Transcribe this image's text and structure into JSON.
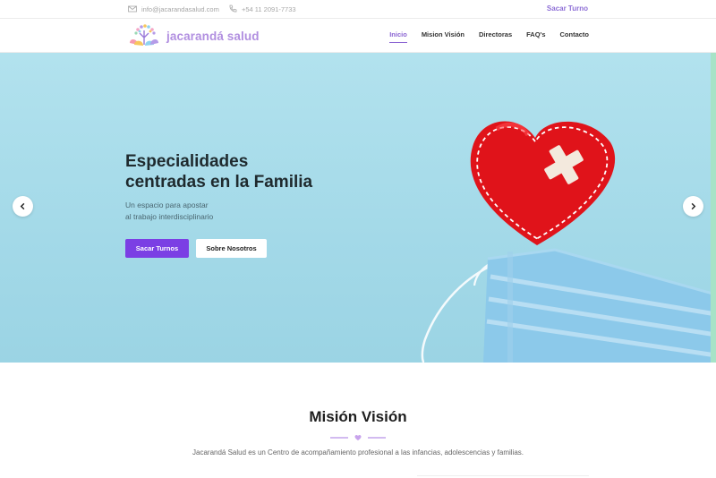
{
  "topbar": {
    "email": "info@jacarandasalud.com",
    "phone": "+54 11 2091-7733",
    "cta_link": "Sacar Turno",
    "email_icon": "mail-icon",
    "phone_icon": "phone-icon"
  },
  "navbar": {
    "brand": "jacarandá salud",
    "items": [
      {
        "label": "Inicio",
        "active": true
      },
      {
        "label": "Mision Visión"
      },
      {
        "label": "Directoras"
      },
      {
        "label": "FAQ's"
      },
      {
        "label": "Contacto"
      }
    ]
  },
  "hero": {
    "title_line1": "Especialidades",
    "title_line2": "centradas en la Familia",
    "subtitle_line1": "Un espacio para apostar",
    "subtitle_line2": "al trabajo interdisciplinario",
    "primary_button": "Sacar Turnos",
    "secondary_button": "Sobre Nosotros",
    "prev_icon": "chevron-left-icon",
    "next_icon": "chevron-right-icon"
  },
  "mision": {
    "title": "Misión Visión",
    "text": "Jacarandá Salud es un Centro de acompañamiento profesional a las infancias, adolescencias y familias.",
    "divider_icon": "heart-icon"
  },
  "colors": {
    "brand_purple": "#7b3fe4",
    "link_purple": "#8a63d2",
    "hero_blue": "#a3d9e8",
    "heart_red": "#e0131a",
    "mask_blue": "#7fc2e6"
  }
}
